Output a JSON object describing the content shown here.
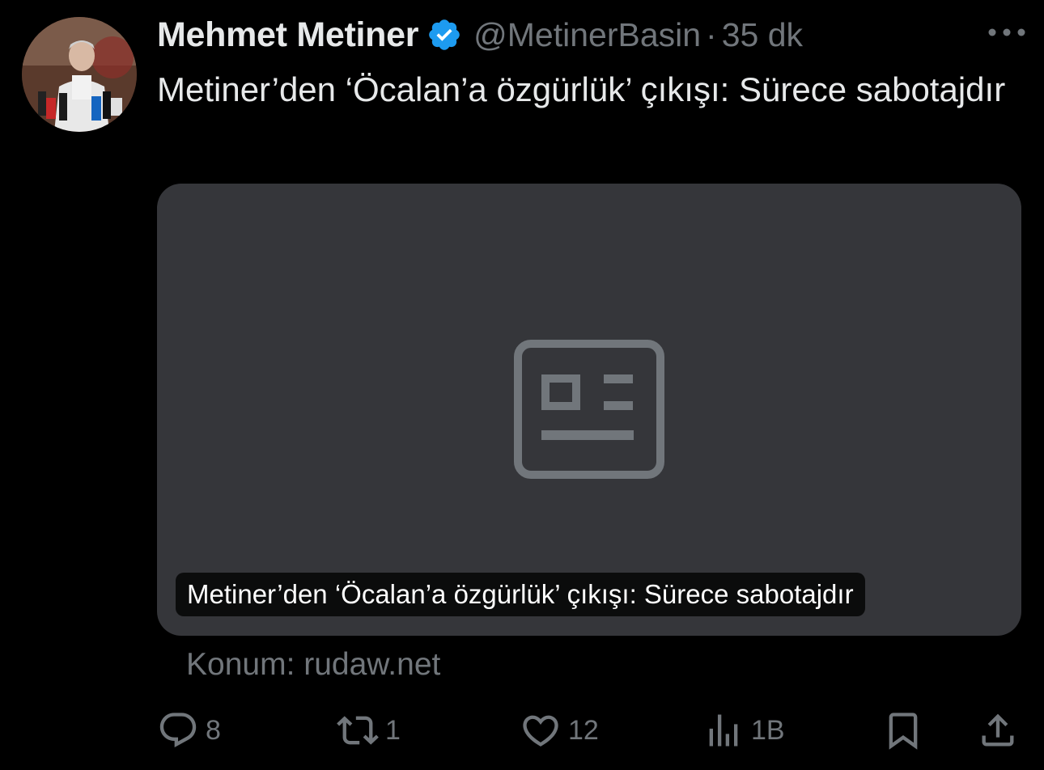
{
  "tweet": {
    "author_name": "Mehmet Metiner",
    "handle": "@MetinerBasin",
    "separator": "·",
    "time": "35 dk",
    "text": "Metiner’den ‘Öcalan’a özgürlük’ çıkışı: Sürece sabotajdır"
  },
  "card": {
    "title": "Metiner’den ‘Öcalan’a özgürlük’ çıkışı: Sürece sabotajdır",
    "placeholder_icon": "news-article-icon"
  },
  "source": {
    "label": "Konum: rudaw.net"
  },
  "actions": {
    "reply_count": "8",
    "retweet_count": "1",
    "like_count": "12",
    "views_count": "1B"
  },
  "colors": {
    "background": "#000000",
    "text": "#e7e9ea",
    "muted": "#71767b",
    "verified": "#1d9bf0",
    "card_bg": "#35363a"
  },
  "icons": [
    "verified-badge-icon",
    "more-icon",
    "reply-icon",
    "retweet-icon",
    "like-icon",
    "views-icon",
    "bookmark-icon",
    "share-icon"
  ]
}
